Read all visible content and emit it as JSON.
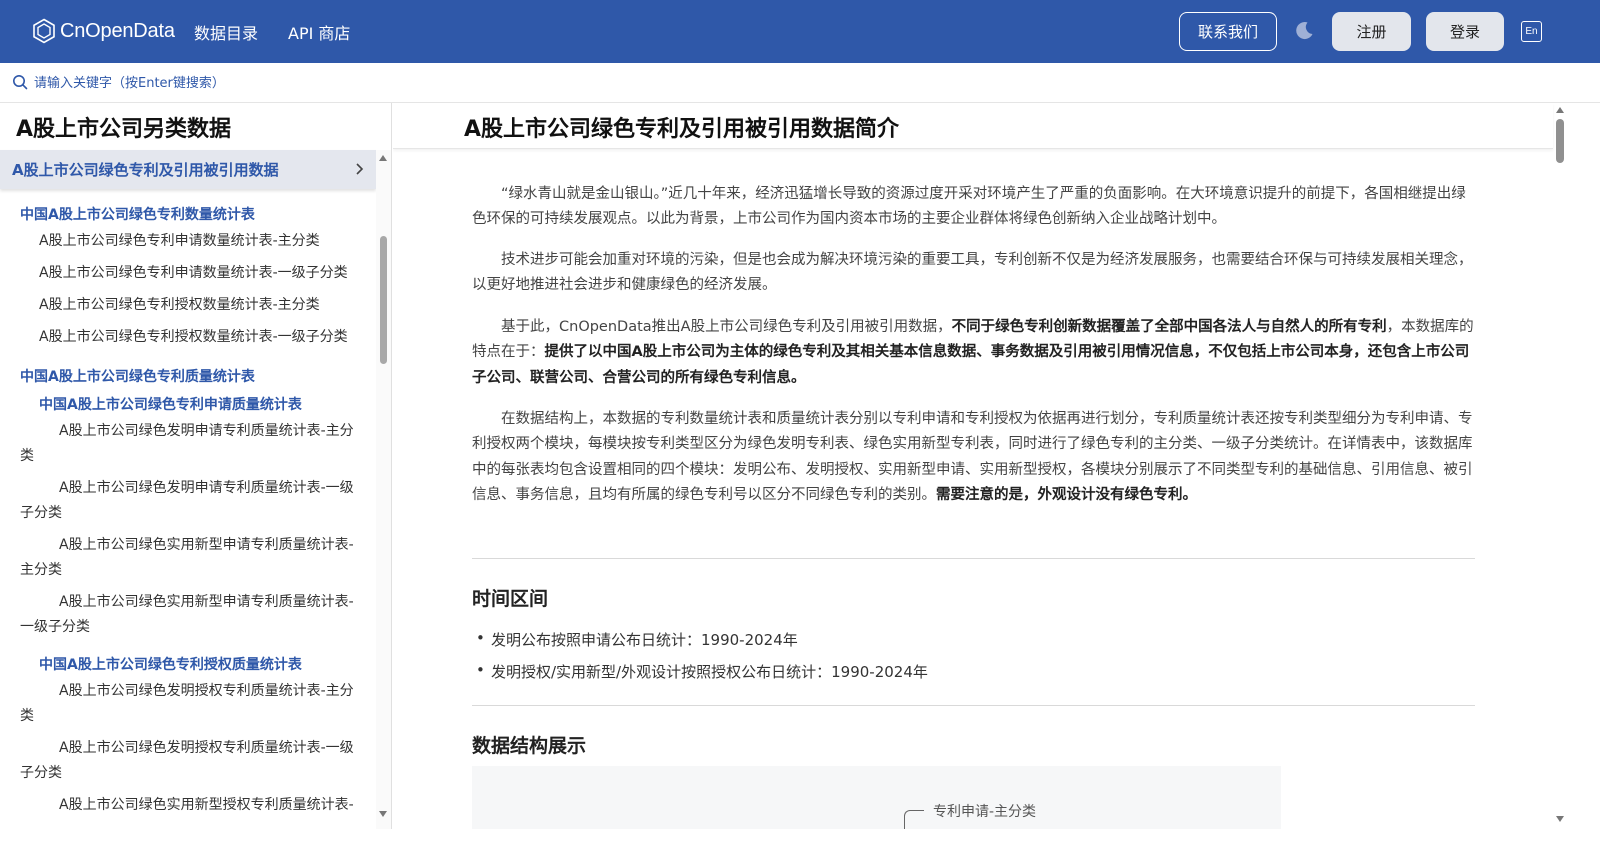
{
  "header": {
    "logo_text": "CnOpenData",
    "nav": [
      "数据目录",
      "API 商店"
    ],
    "contact_label": "联系我们",
    "register_label": "注册",
    "login_label": "登录",
    "lang_label": "En",
    "theme_icon": "moon-icon",
    "brand_color": "#2f58a9"
  },
  "search": {
    "placeholder": "请输入关键字（按Enter键搜索）",
    "icon": "search-icon"
  },
  "sidebar": {
    "title": "A股上市公司另类数据",
    "active_section": "A股上市公司绿色专利及引用被引用数据",
    "cat_1": "中国A股上市公司绿色专利数量统计表",
    "items_1": [
      "A股上市公司绿色专利申请数量统计表-主分类",
      "A股上市公司绿色专利申请数量统计表-一级子分类",
      "A股上市公司绿色专利授权数量统计表-主分类",
      "A股上市公司绿色专利授权数量统计表-一级子分类"
    ],
    "cat_2": "中国A股上市公司绿色专利质量统计表",
    "sub_2a": "中国A股上市公司绿色专利申请质量统计表",
    "items_2a": [
      [
        "A股上市公司绿色发明申请专利质量统计表-主分",
        "类"
      ],
      [
        "A股上市公司绿色发明申请专利质量统计表-一级",
        "子分类"
      ],
      [
        "A股上市公司绿色实用新型申请专利质量统计表-",
        "主分类"
      ],
      [
        "A股上市公司绿色实用新型申请专利质量统计表-",
        "一级子分类"
      ]
    ],
    "sub_2b": "中国A股上市公司绿色专利授权质量统计表",
    "items_2b": [
      [
        "A股上市公司绿色发明授权专利质量统计表-主分",
        "类"
      ],
      [
        "A股上市公司绿色发明授权专利质量统计表-一级",
        "子分类"
      ],
      [
        "A股上市公司绿色实用新型授权专利质量统计表-",
        ""
      ]
    ]
  },
  "main": {
    "title": "A股上市公司绿色专利及引用被引用数据简介",
    "p1": "“绿水青山就是金山银山。”近几十年来，经济迅猛增长导致的资源过度开采对环境产生了严重的负面影响。在大环境意识提升的前提下，各国相继提出绿色环保的可持续发展观点。以此为背景，上市公司作为国内资本市场的主要企业群体将绿色创新纳入企业战略计划中。",
    "p2": "技术进步可能会加重对环境的污染，但是也会成为解决环境污染的重要工具，专利创新不仅是为经济发展服务，也需要结合环保与可持续发展相关理念，以更好地推进社会进步和健康绿色的经济发展。",
    "p3_a": "基于此，CnOpenData推出A股上市公司绿色专利及引用被引用数据，",
    "p3_b": "不同于绿色专利创新数据覆盖了全部中国各法人与自然人的所有专利",
    "p3_c": "，本数据库的特点在于：",
    "p3_d": "提供了以中国A股上市公司为主体的绿色专利及其相关基本信息数据、事务数据及引用被引用情况信息，不仅包括上市公司本身，还包含上市公司子公司、联营公司、合营公司的所有绿色专利信息。",
    "p4_a": "在数据结构上，本数据的专利数量统计表和质量统计表分别以专利申请和专利授权为依据再进行划分，专利质量统计表还按专利类型细分为专利申请、专利授权两个模块，每模块按专利类型区分为绿色发明专利表、绿色实用新型专利表，同时进行了绿色专利的主分类、一级子分类统计。在详情表中，该数据库中的每张表均包含设置相同的四个模块：发明公布、发明授权、实用新型申请、实用新型授权，各模块分别展示了不同类型专利的基础信息、引用信息、被引信息、事务信息，且均有所属的绿色专利号以区分不同绿色专利的类别。",
    "p4_b": "需要注意的是，外观设计没有绿色专利。",
    "h_time": "时间区间",
    "time_items": [
      "发明公布按照申请公布日统计：1990-2024年",
      "发明授权/实用新型/外观设计按照授权公布日统计：1990-2024年"
    ],
    "h_struct": "数据结构展示",
    "tree_label": "专利申请-主分类"
  }
}
